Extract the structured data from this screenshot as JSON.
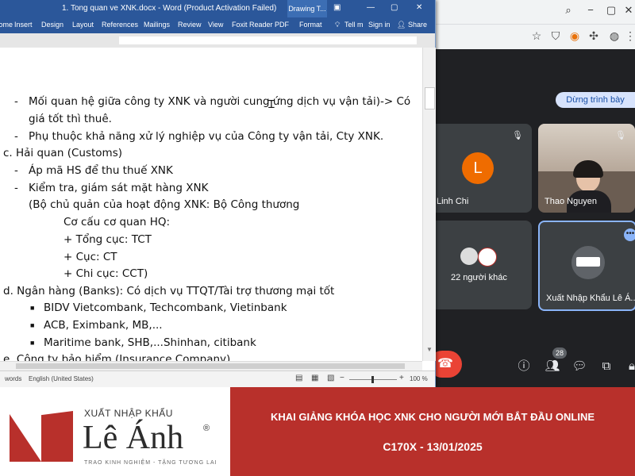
{
  "word": {
    "title": "1. Tong quan ve XNK.docx - Word (Product Activation Failed)",
    "context_tab": "Drawing T...",
    "ribbon_tabs": [
      "Home",
      "Insert",
      "Design",
      "Layout",
      "References",
      "Mailings",
      "Review",
      "View",
      "Foxit Reader PDF",
      "Format"
    ],
    "tell_me": "Tell m",
    "sign_in": "Sign in",
    "share": "Share",
    "status": {
      "words": "words",
      "language": "English (United States)",
      "zoom": "100 %"
    },
    "doc_lines": [
      "Mối quan hệ giữa công ty XNK và người cung ứng dịch vụ vận tải)-> Có",
      "giá tốt thì thuê.",
      "Phụ thuộc khả năng xử lý nghiệp vụ của Công ty vận tải, Cty XNK.",
      "c.  Hải quan (Customs)",
      "Áp mã HS để thu thuế XNK",
      "Kiểm tra, giám sát mặt hàng XNK",
      "(Bộ chủ quản của hoạt động XNK: Bộ Công thương",
      "Cơ cấu cơ quan HQ:",
      "+ Tổng cục: TCT",
      "+ Cục: CT",
      "+ Chi cục: CCT)",
      "d.  Ngân hàng (Banks): Có dịch vụ TTQT/Tài trợ thương mại tốt",
      "BIDV Vietcombank, Techcombank, Vietinbank",
      "ACB, Eximbank, MB,...",
      "Maritime bank, SHB,...Shinhan, citibank",
      "e.  Công ty bảo hiểm (Insurance Company)"
    ]
  },
  "meet": {
    "stop_presenting": "Dừng trình bày",
    "participants": [
      {
        "name": "Linh Chi",
        "avatar_letter": "L",
        "avatar_color": "#ef6c00"
      },
      {
        "name": "Thao Nguyen"
      },
      {
        "name": "22 người khác"
      },
      {
        "name": "Xuất Nhập Khẩu Lê Á..."
      }
    ],
    "people_count": "28"
  },
  "banner": {
    "brand_top": "XUẤT NHẬP KHẨU",
    "brand_name": "Lê Ánh",
    "registered": "®",
    "slogan": "TRAO KINH NGHIỆM - TẶNG TƯƠNG LAI",
    "headline": "KHAI GIẢNG KHÓA HỌC XNK CHO NGƯỜI MỚI BẮT ĐẦU ONLINE",
    "subline": "C170X - 13/01/2025",
    "colors": {
      "brand_red": "#b8302b",
      "word_blue": "#2b579a"
    }
  }
}
